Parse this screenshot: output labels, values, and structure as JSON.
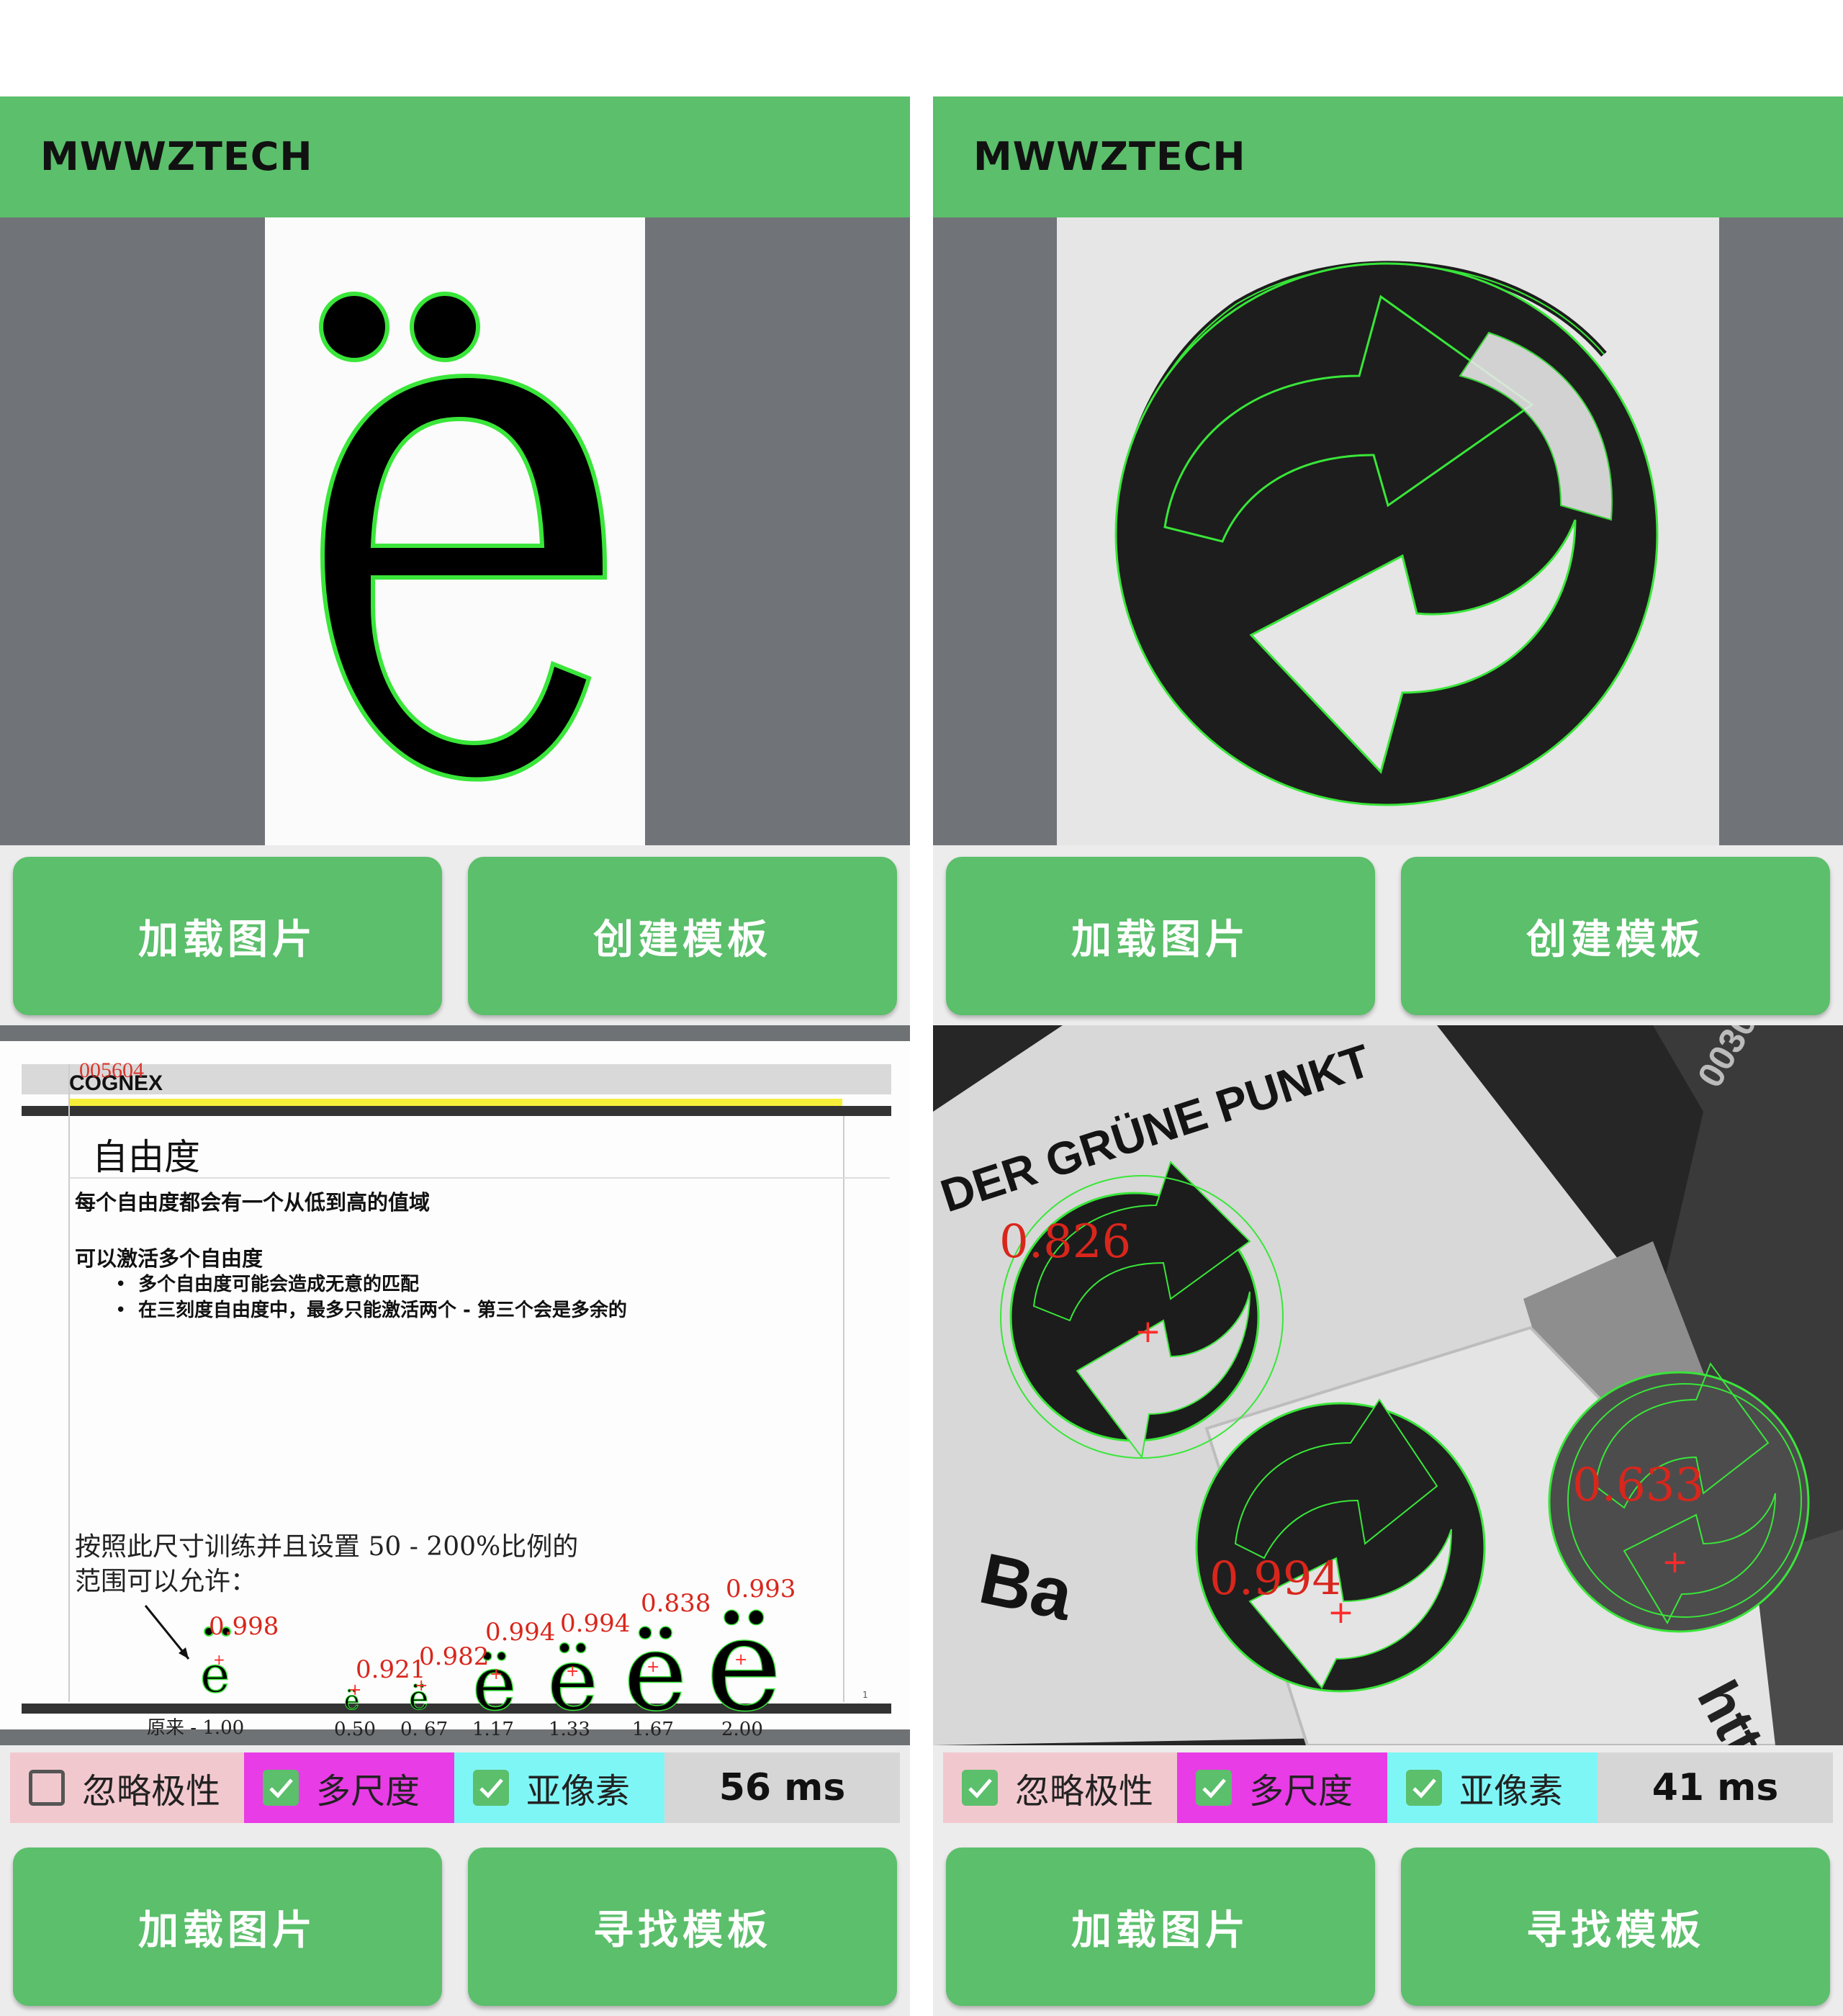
{
  "panels": [
    {
      "app_title": "MWWZTECH",
      "load_button": "加载图片",
      "create_button": "创建模板",
      "find_load_button": "加载图片",
      "find_button": "寻找模板",
      "options": [
        {
          "label": "忽略极性",
          "checked": false
        },
        {
          "label": "多尺度",
          "checked": true
        },
        {
          "label": "亚像素",
          "checked": true
        }
      ],
      "timing": "56 ms",
      "result": {
        "logo_overlay": "005604",
        "logo": "COGNEX",
        "slide_title": "自由度",
        "line1": "每个自由度都会有一个从低到高的值域",
        "line2": "可以激活多个自由度",
        "bullet1": "多个自由度可能会造成无意的匹配",
        "bullet2": "在三刻度自由度中，最多只能激活两个 - 第三个会是多余的",
        "para1": "按照此尺寸训练并且设置 50 - 200%比例的",
        "para2": "范围可以允许：",
        "original_label": "原来 - 1.00",
        "original_score": "0.998",
        "scales": [
          "0.50",
          "0. 67",
          "1.17",
          "1.33",
          "1.67",
          "2.00"
        ],
        "scores": [
          "0.921",
          "0.982",
          "0.994",
          "0.994",
          "0.838",
          "0.993"
        ],
        "page_no": "1"
      }
    },
    {
      "app_title": "MWWZTECH",
      "load_button": "加载图片",
      "create_button": "创建模板",
      "find_load_button": "加载图片",
      "find_button": "寻找模板",
      "options": [
        {
          "label": "忽略极性",
          "checked": true
        },
        {
          "label": "多尺度",
          "checked": true
        },
        {
          "label": "亚像素",
          "checked": true
        }
      ],
      "timing": "41 ms",
      "result": {
        "sign_text": "DER GRÜNE PUNKT",
        "sign_text2": "Ba",
        "scores": [
          "0.826",
          "0.994",
          "0.633"
        ]
      }
    }
  ],
  "colors": {
    "accent": "#5bbf6b",
    "contour": "#39e639",
    "score": "#d9261c"
  }
}
